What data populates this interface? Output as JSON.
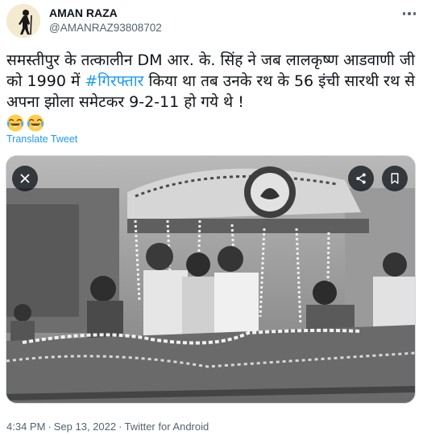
{
  "tweet": {
    "author": {
      "name": "AMAN RAZA",
      "handle": "@AMANRAZ93808702"
    },
    "text": {
      "part1": "समस्तीपुर के तत्कालीन DM आर. के. सिंह  ने जब लालकृष्ण आडवाणी जी को 1990 में ",
      "hashtag": "#गिरफ्तार",
      "part2": " किया था तब उनके रथ के 56 इंची सारथी रथ से अपना झोला समेटकर 9-2-11 हो गये थे !"
    },
    "emojis": [
      "face-with-tears-of-joy",
      "face-with-tears-of-joy"
    ],
    "translate_label": "Translate Tweet",
    "media": {
      "description_icons": [
        "close-icon",
        "share-icon",
        "bookmark-icon"
      ]
    },
    "meta": {
      "time": "4:34 PM",
      "date": "Sep 13, 2022",
      "source": "Twitter for Android",
      "separator": "·"
    }
  },
  "colors": {
    "link": "#1d9bf0",
    "secondary_text": "#536471",
    "text": "#0f1419",
    "border": "#cfd9de"
  }
}
